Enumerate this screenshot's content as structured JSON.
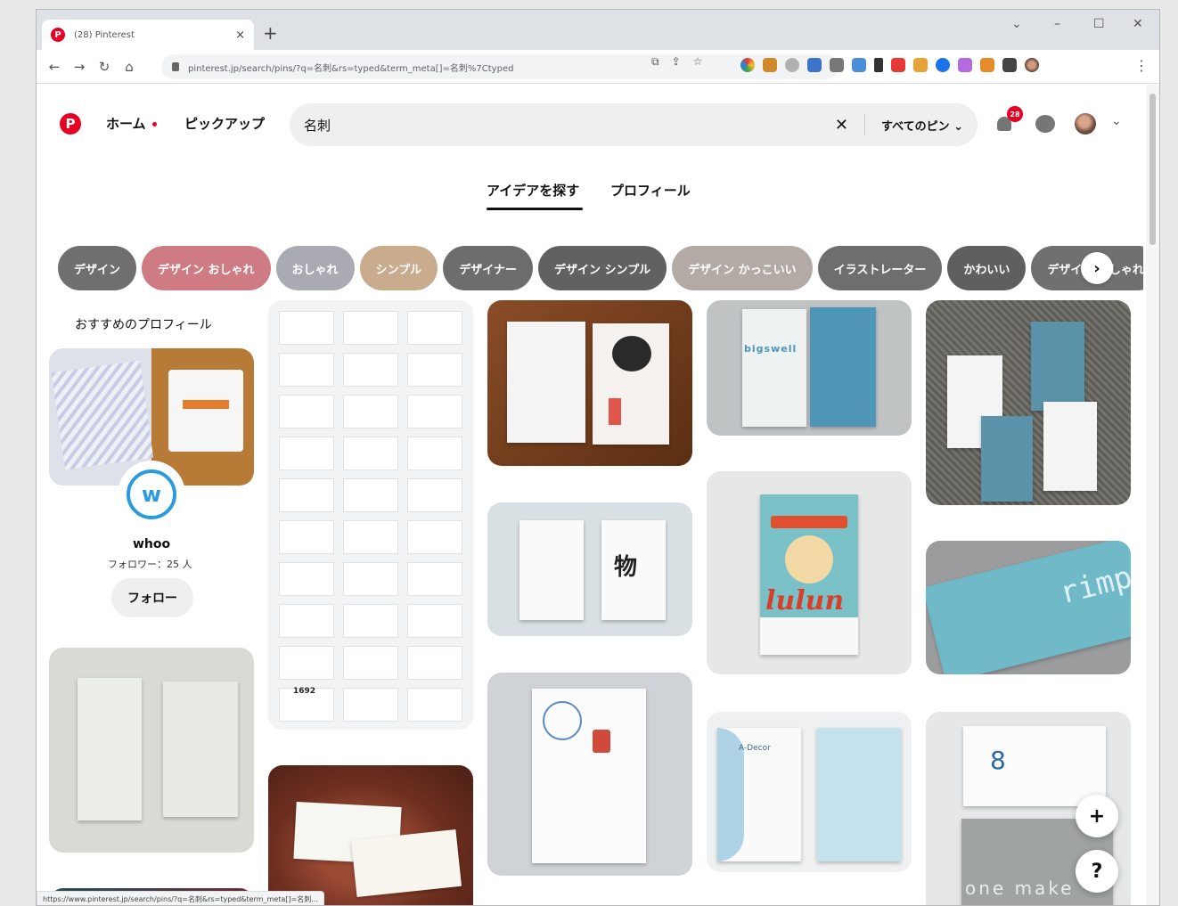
{
  "browser": {
    "tab_title": "(28) Pinterest",
    "tab_close": "×",
    "new_tab": "+",
    "url": "pinterest.jp/search/pins/?q=名刺&rs=typed&term_meta[]=名刺%7Ctyped",
    "status_url": "https://www.pinterest.jp/search/pins/?q=名刺&rs=typed&term_meta[]=名刺...",
    "window_controls": [
      "⌄",
      "–",
      "☐",
      "✕"
    ],
    "nav": {
      "back": "←",
      "forward": "→",
      "reload": "↻",
      "home": "⌂"
    },
    "menu": "⋮"
  },
  "header": {
    "logo": "P",
    "home": "ホーム",
    "pickup": "ピックアップ",
    "search_value": "名刺",
    "search_clear": "✕",
    "filter": "すべてのピン ⌄",
    "notification_count": "28",
    "account_chevron": "⌄"
  },
  "subtabs": [
    "アイデアを探す",
    "プロフィール"
  ],
  "chips": [
    {
      "label": "デザイン",
      "color": "#6f6f6f"
    },
    {
      "label": "デザイン おしゃれ",
      "color": "#cf7b83"
    },
    {
      "label": "おしゃれ",
      "color": "#aaaab2"
    },
    {
      "label": "シンプル",
      "color": "#c9ab8e"
    },
    {
      "label": "デザイナー",
      "color": "#6d6d6d"
    },
    {
      "label": "デザイン シンプル",
      "color": "#616161"
    },
    {
      "label": "デザイン かっこいい",
      "color": "#b3aaa6"
    },
    {
      "label": "イラストレーター",
      "color": "#6e6e6e"
    },
    {
      "label": "かわいい",
      "color": "#5f5f5f"
    },
    {
      "label": "デザイン おしゃれ",
      "color": "#707070"
    }
  ],
  "chip_arrow": "›",
  "recommended": {
    "title": "おすすめのプロフィール",
    "logo_glyph": "w",
    "name": "whoo",
    "followers": "フォロワー：25 人",
    "follow_label": "フォロー"
  },
  "pins": {
    "bigswell": "bigswell",
    "rimp": "rimp",
    "lulun": "lulun",
    "one_make": "one make",
    "kanji": "物",
    "grid_label": "1692",
    "adecor": "A-Decor"
  },
  "fab": {
    "add": "+",
    "help": "?"
  }
}
